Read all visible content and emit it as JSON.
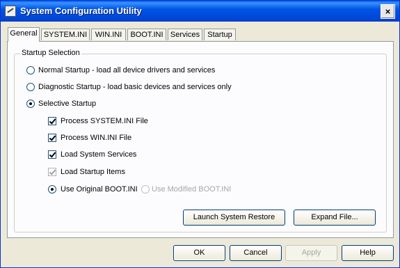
{
  "window": {
    "title": "System Configuration Utility",
    "close_symbol": "×"
  },
  "tabs": [
    "General",
    "SYSTEM.INI",
    "WIN.INI",
    "BOOT.INI",
    "Services",
    "Startup"
  ],
  "active_tab": "General",
  "group": {
    "label": "Startup Selection",
    "radios": [
      {
        "label": "Normal Startup - load all device drivers and services",
        "checked": false
      },
      {
        "label": "Diagnostic Startup - load basic devices and services only",
        "checked": false
      },
      {
        "label": "Selective Startup",
        "checked": true
      }
    ],
    "checkboxes": [
      {
        "label": "Process SYSTEM.INI File",
        "checked": true,
        "enabled": true
      },
      {
        "label": "Process WIN.INI File",
        "checked": true,
        "enabled": true
      },
      {
        "label": "Load System Services",
        "checked": true,
        "enabled": true
      },
      {
        "label": "Load Startup Items",
        "checked": true,
        "enabled": false
      }
    ],
    "boot_options": [
      {
        "label": "Use Original BOOT.INI",
        "checked": true,
        "enabled": true
      },
      {
        "label": "Use Modified BOOT.INI",
        "checked": false,
        "enabled": false
      }
    ],
    "launch_restore_label": "Launch System Restore",
    "expand_file_label": "Expand File..."
  },
  "buttons": {
    "ok": "OK",
    "cancel": "Cancel",
    "apply": "Apply",
    "help": "Help"
  }
}
